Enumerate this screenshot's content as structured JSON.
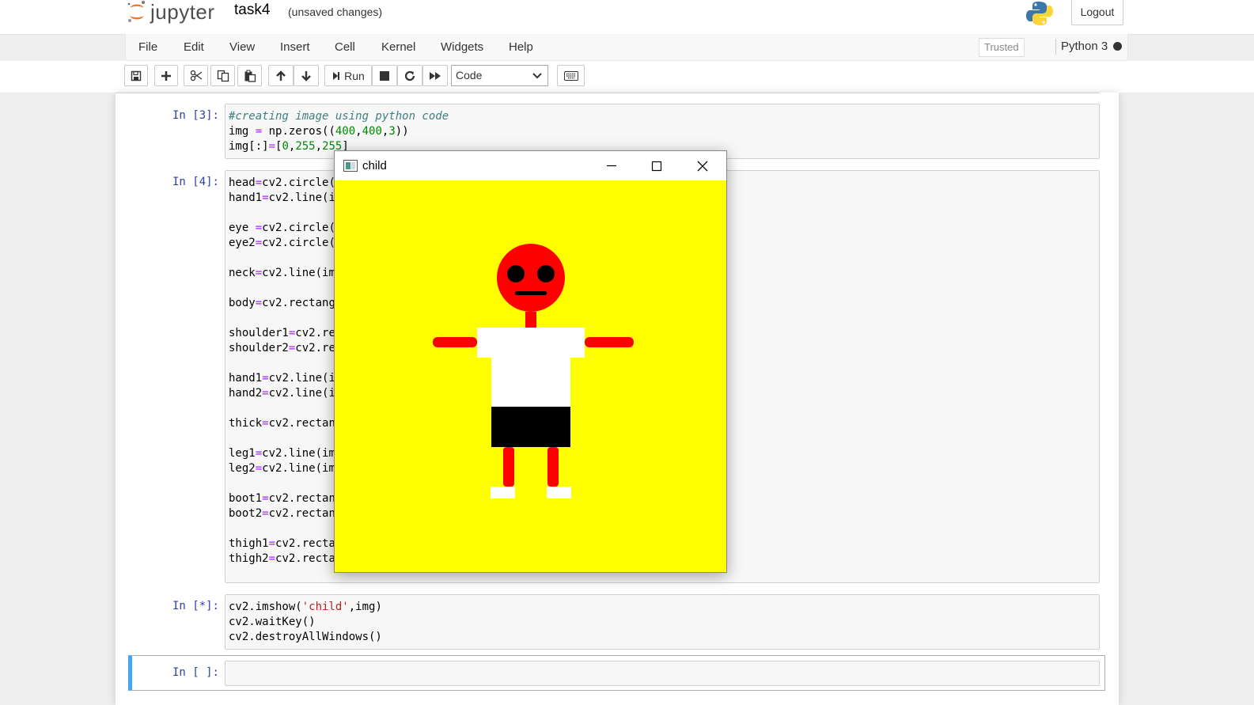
{
  "header": {
    "logo_text": "jupyter",
    "notebook_name": "task4",
    "save_status": "(unsaved changes)",
    "logout_label": "Logout"
  },
  "menubar": {
    "items": [
      "File",
      "Edit",
      "View",
      "Insert",
      "Cell",
      "Kernel",
      "Widgets",
      "Help"
    ],
    "trusted_label": "Trusted",
    "kernel_name": "Python 3"
  },
  "toolbar": {
    "run_label": "Run",
    "cell_type": "Code",
    "icons": [
      "save-icon",
      "plus-icon",
      "cut-icon",
      "copy-icon",
      "paste-icon",
      "arrow-up-icon",
      "arrow-down-icon",
      "run-icon",
      "stop-icon",
      "restart-icon",
      "fast-forward-icon",
      "keyboard-icon"
    ]
  },
  "cells": [
    {
      "prompt": "In [3]:",
      "lines": [
        "#creating image using python code",
        "img = np.zeros((400,400,3))",
        "img[:]=[0,255,255]"
      ]
    },
    {
      "prompt": "In [4]:",
      "lines": [
        "head=cv2.circle(",
        "hand1=cv2.line(i",
        "",
        "eye =cv2.circle(",
        "eye2=cv2.circle(",
        "",
        "neck=cv2.line(im",
        "",
        "body=cv2.rectang",
        "",
        "shoulder1=cv2.re",
        "shoulder2=cv2.re",
        "",
        "hand1=cv2.line(i",
        "hand2=cv2.line(i",
        "",
        "thick=cv2.rectan",
        "",
        "leg1=cv2.line(im",
        "leg2=cv2.line(im",
        "",
        "boot1=cv2.rectan",
        "boot2=cv2.rectan",
        "",
        "thigh1=cv2.recta",
        "thigh2=cv2.recta"
      ]
    },
    {
      "prompt": "In [*]:",
      "lines": [
        "cv2.imshow('child',img)",
        "cv2.waitKey()",
        "cv2.destroyAllWindows()"
      ]
    },
    {
      "prompt": "In [ ]:",
      "lines": []
    }
  ],
  "window": {
    "title": "child",
    "controls": [
      "minimize-icon",
      "maximize-icon",
      "close-icon"
    ],
    "canvas_background": "#ffff00",
    "figure_colors": {
      "skin": "#ff0000",
      "shirt": "#ffffff",
      "shorts": "#000000",
      "boots": "#ffffff",
      "eyes": "#000000"
    }
  },
  "colors": {
    "prompt": "#303f9f",
    "selected_cell_border": "#42a5f5",
    "comment": "#408080",
    "number": "#008800",
    "operator": "#aa22ff",
    "string": "#ba2121"
  }
}
